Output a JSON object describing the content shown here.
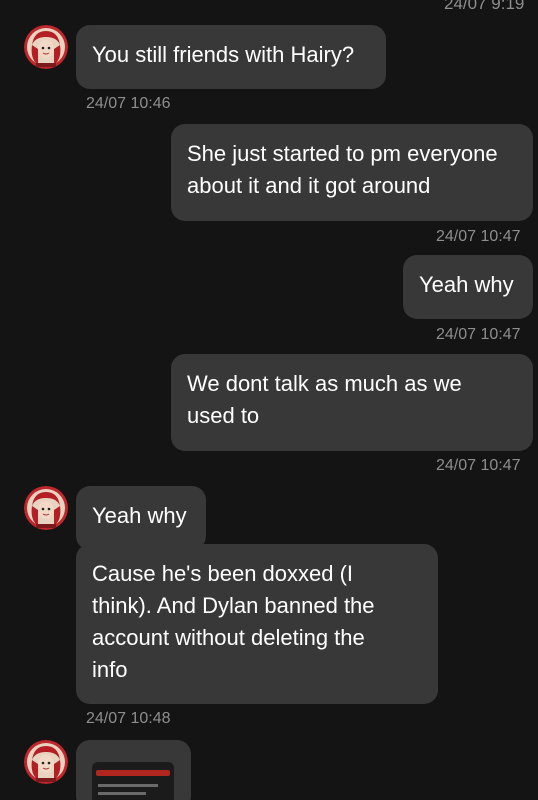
{
  "status_time": "24/07 9:19",
  "messages": [
    {
      "text": "You still friends with Hairy?",
      "timestamp": "24/07 10:46"
    },
    {
      "text": "She just started to pm everyone about it and it got around",
      "timestamp": "24/07 10:47"
    },
    {
      "text": "Yeah why",
      "timestamp": "24/07 10:47"
    },
    {
      "text": "We dont talk as much as we used to",
      "timestamp": "24/07 10:47"
    },
    {
      "text": "Yeah why"
    },
    {
      "text": "Cause he's been doxxed (I think). And Dylan banned the account without deleting the info",
      "timestamp": "24/07 10:48"
    }
  ],
  "colors": {
    "background": "#141414",
    "bubble": "#383838",
    "text": "#ffffff",
    "timestamp": "#8e8e8e",
    "avatar_red": "#c0272d"
  },
  "icons": {
    "avatar": "contact-avatar-red-character",
    "attachment": "image-attachment-thumbnail"
  }
}
